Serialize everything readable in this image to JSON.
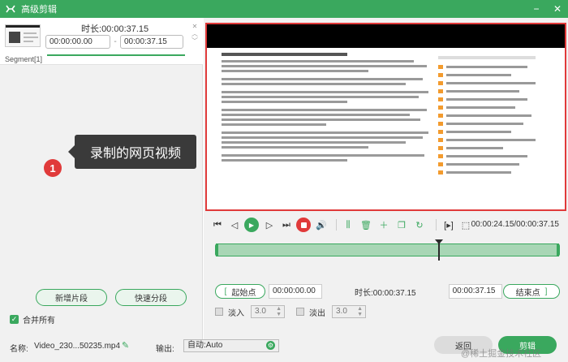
{
  "window": {
    "title": "高级剪辑",
    "minimize": "−",
    "close": "✕"
  },
  "segment": {
    "duration_label": "时长:",
    "duration": "00:00:37.15",
    "start": "00:00:00.00",
    "end": "00:00:37.15",
    "label": "Segment[1]"
  },
  "callout": {
    "number": "1",
    "text": "录制的网页视频"
  },
  "buttons": {
    "add_segment": "新增片段",
    "quick_split": "快速分段",
    "merge_all": "合并所有",
    "back": "返回",
    "cut": "剪辑"
  },
  "player": {
    "time_readout": "00:00:24.15/00:00:37.15"
  },
  "range": {
    "start_point": "起始点",
    "start_time": "00:00:00.00",
    "duration_label": "时长:",
    "duration": "00:00:37.15",
    "end_time": "00:00:37.15",
    "end_point": "结束点"
  },
  "fade": {
    "fade_in": "淡入",
    "fade_in_value": "3.0",
    "fade_out": "淡出",
    "fade_out_value": "3.0"
  },
  "footer": {
    "name_label": "名称:",
    "filename": "Video_230...50235.mp4",
    "output_label": "输出:",
    "output_value": "自动:Auto",
    "watermark": "@稀土掘金技术社区"
  },
  "playback": {
    "progress": 0.65
  },
  "colors": {
    "accent": "#3aa85e",
    "danger": "#e03a3a"
  }
}
